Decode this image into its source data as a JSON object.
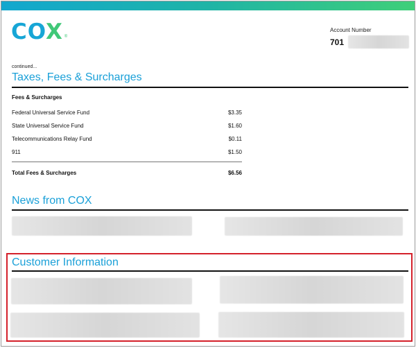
{
  "logo": {
    "text_main": "CO",
    "text_x": "X",
    "reg": "®"
  },
  "account": {
    "label": "Account Number",
    "number": "701"
  },
  "continued": "continued...",
  "taxes_section": {
    "title": "Taxes, Fees & Surcharges",
    "subheading": "Fees & Surcharges",
    "rows": [
      {
        "label": "Federal Universal Service Fund",
        "amount": "$3.35"
      },
      {
        "label": "State Universal Service Fund",
        "amount": "$1.60"
      },
      {
        "label": "Telecommunications Relay Fund",
        "amount": "$0.11"
      },
      {
        "label": "911",
        "amount": "$1.50"
      }
    ],
    "total": {
      "label": "Total Fees & Surcharges",
      "amount": "$6.56"
    }
  },
  "news_section": {
    "title": "News from COX"
  },
  "customer_section": {
    "title": "Customer Information"
  },
  "colors": {
    "brand_blue": "#1aa0d8",
    "brand_green": "#40c878",
    "highlight_red": "#d4202a"
  }
}
